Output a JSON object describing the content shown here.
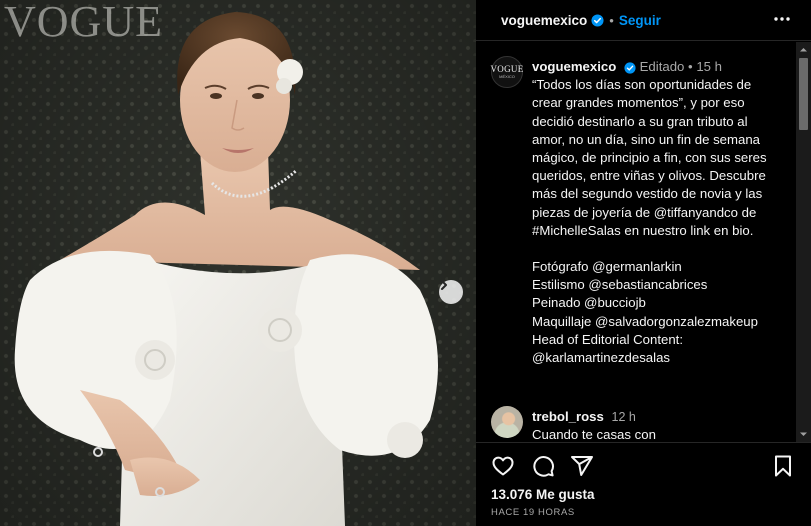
{
  "photo": {
    "watermark": "VOGUE",
    "next_label": "Next"
  },
  "header": {
    "username": "voguemexico",
    "separator": "•",
    "follow_label": "Seguir",
    "more_icon": "more-horizontal-icon",
    "verified_icon": "verified-badge-icon"
  },
  "caption": {
    "avatar_text": "VOGUE",
    "avatar_subtext": "MÉXICO",
    "username": "voguemexico",
    "edited": "Editado",
    "separator": "•",
    "age": "15 h",
    "lines": [
      "“Todos los días son oportunidades de",
      "crear grandes momentos”, y por eso",
      "decidió destinarlo a su gran tributo al",
      "amor, no un día, sino un fin de semana",
      "mágico, de principio a fin, con sus seres",
      "queridos, entre viñas y olivos. Descubre",
      "más del segundo vestido de novia y las",
      "piezas de joyería de @tiffanyandco de",
      "#MichelleSalas en nuestro link en bio."
    ],
    "credits": [
      "Fotógrafo @germanlarkin",
      "Estilismo @sebastiancabrices",
      "Peinado @bucciojb",
      "Maquillaje @salvadorgonzalezmakeup",
      "Head of Editorial Content:",
      "@karlamartinezdesalas"
    ]
  },
  "comment": {
    "username": "trebol_ross",
    "age": "12 h",
    "text": "Cuando te casas con"
  },
  "actions": {
    "like_icon": "heart-icon",
    "comment_icon": "comment-icon",
    "share_icon": "share-icon",
    "save_icon": "bookmark-icon"
  },
  "likes": "13.076 Me gusta",
  "time": "HACE 19 HORAS",
  "colors": {
    "background": "#000000",
    "text": "#f5f5f5",
    "secondary_text": "#a8a8a8",
    "accent": "#0095f6",
    "divider": "#262626"
  }
}
